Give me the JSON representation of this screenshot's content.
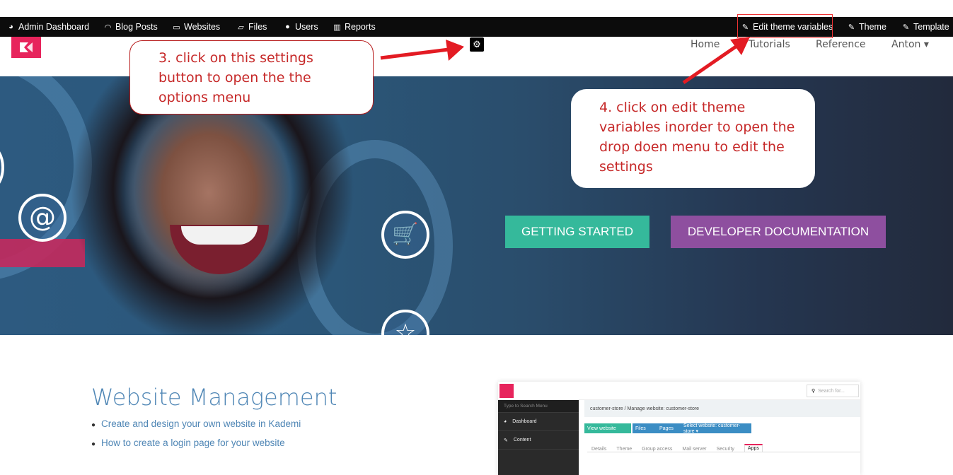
{
  "admin_bar": {
    "items": [
      {
        "label": "Admin Dashboard",
        "icon": "dashboard-icon",
        "glyph": "◕"
      },
      {
        "label": "Blog Posts",
        "icon": "rss-icon",
        "glyph": "◠"
      },
      {
        "label": "Websites",
        "icon": "laptop-icon",
        "glyph": "▭"
      },
      {
        "label": "Files",
        "icon": "folder-open-icon",
        "glyph": "▱"
      },
      {
        "label": "Users",
        "icon": "user-icon",
        "glyph": "●"
      },
      {
        "label": "Reports",
        "icon": "bar-chart-icon",
        "glyph": "▥"
      }
    ],
    "right_items": [
      {
        "label": "Edit theme variables",
        "icon": "brush-icon",
        "glyph": "✎"
      },
      {
        "label": "Theme",
        "icon": "pencil-icon",
        "glyph": "✎"
      },
      {
        "label": "Template",
        "icon": "pencil-icon",
        "glyph": "✎"
      }
    ]
  },
  "header": {
    "settings_glyph": "⚙",
    "nav": [
      "Home",
      "Tutorials",
      "Reference",
      "Anton ▾"
    ]
  },
  "hero": {
    "buttons": [
      {
        "label": "GETTING STARTED",
        "color": "#35b99b"
      },
      {
        "label": "DEVELOPER DOCUMENTATION",
        "color": "#8e4f9f"
      }
    ],
    "icons": [
      "@",
      "🛒",
      "☆"
    ]
  },
  "annotations": {
    "step3": "3. click on this settings button to open the  the options menu",
    "step4": "4. click on edit theme variables inorder to open the drop doen menu to edit the settings",
    "arrow_color": "#e31b23"
  },
  "content": {
    "title": "Website Management",
    "links": [
      "Create and design your own website in Kademi",
      "How to create a login page for your website"
    ]
  },
  "preview": {
    "search_placeholder": "Search for...",
    "sidebar_search": "Type to Search Menu",
    "sidebar": [
      "Dashboard",
      "Content"
    ],
    "breadcrumb": "customer-store  /  Manage website: customer-store",
    "buttons": [
      "View website",
      "Files",
      "Pages",
      "Select website: customer-store ▾"
    ],
    "tabs": [
      "Details",
      "Theme",
      "Group access",
      "Mail server",
      "Security",
      "Apps"
    ]
  },
  "colors": {
    "brand": "#e7245c",
    "link": "#4f86b5"
  }
}
